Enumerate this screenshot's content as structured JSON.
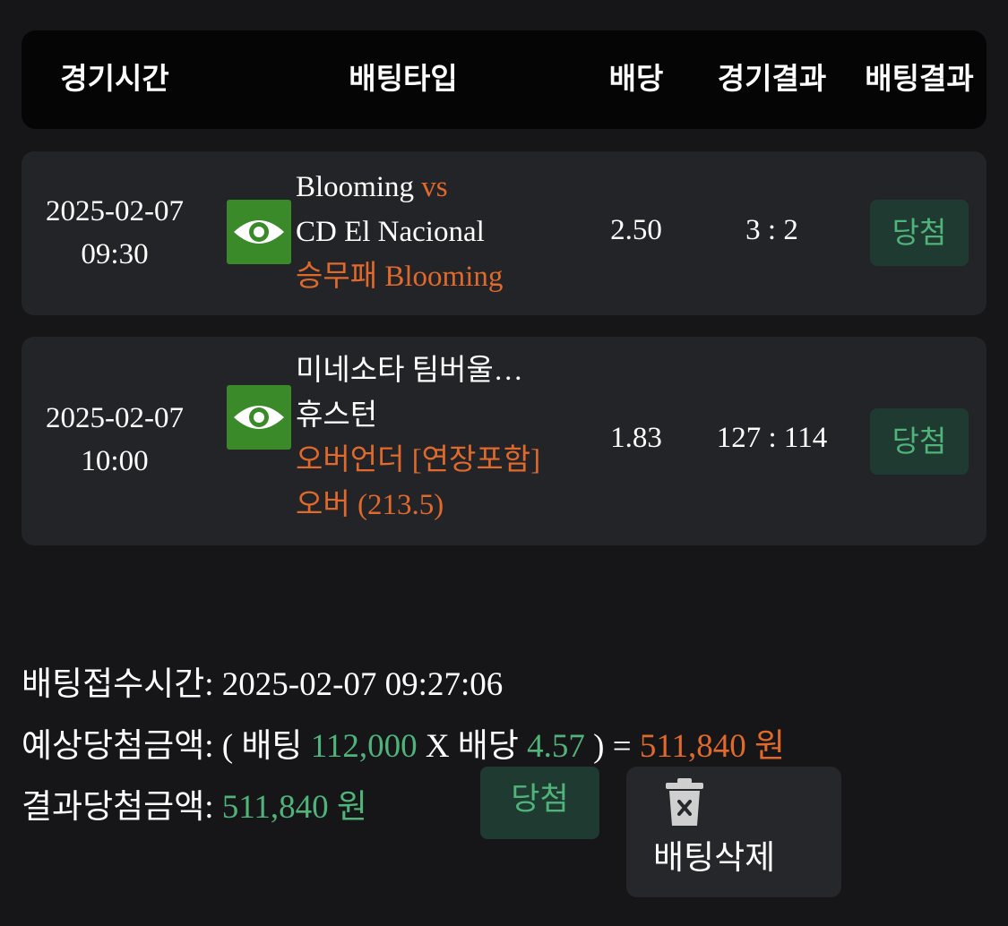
{
  "header": {
    "col_time": "경기시간",
    "col_type": "배팅타입",
    "col_odds": "배당",
    "col_match_result": "경기결과",
    "col_bet_result": "배팅결과"
  },
  "bets": [
    {
      "date": "2025-02-07",
      "time": "09:30",
      "icon": "eye-icon",
      "home": "Blooming",
      "vs": "vs",
      "away": "CD El Nacional",
      "market": "승무패",
      "pick": "Blooming",
      "odds": "2.50",
      "score": "3 : 2",
      "result": "당첨"
    },
    {
      "date": "2025-02-07",
      "time": "10:00",
      "icon": "eye-icon",
      "home": "미네소타 팀버울…",
      "away": "휴스턴",
      "market": "오버언더 [연장포함]",
      "pick": "오버 (213.5)",
      "odds": "1.83",
      "score": "127 : 114",
      "result": "당첨"
    }
  ],
  "summary": {
    "bet_time_label": "배팅접수시간:",
    "bet_time_value": "2025-02-07 09:27:06",
    "expected_label": "예상당첨금액:",
    "expected_open": "( 배팅",
    "stake": "112,000",
    "times": "X 배당",
    "total_odds": "4.57",
    "expected_close": ") =",
    "expected_amount": "511,840 원",
    "result_label": "결과당첨금액:",
    "result_amount": "511,840 원",
    "status_badge": "당첨",
    "delete_label": "배팅삭제"
  },
  "colors": {
    "background": "#161618",
    "row": "#232428",
    "accent_orange": "#e0692b",
    "accent_green": "#4fb37a",
    "eye_bg": "#3a8a2a"
  }
}
